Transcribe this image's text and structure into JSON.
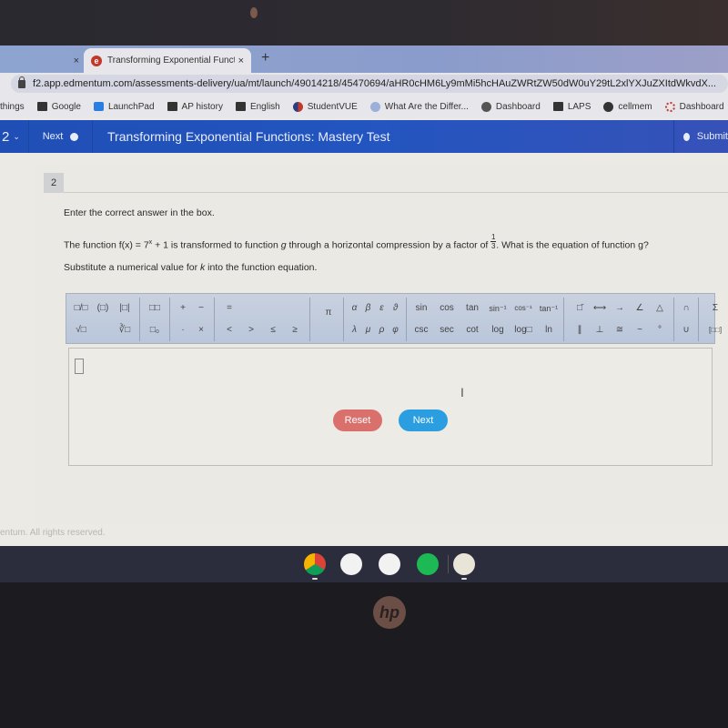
{
  "browser": {
    "prev_tab_close": "×",
    "active_tab": {
      "title": "Transforming Exponential Funct",
      "close": "×",
      "favicon": "e"
    },
    "new_tab": "+",
    "url": "f2.app.edmentum.com/assessments-delivery/ua/mt/launch/49014218/45470694/aHR0cHM6Ly9mMi5hcHAuZWRtZW50dW0uY29tL2xlYXJuZXItdWkvdX...",
    "bookmarks": [
      {
        "label": "things",
        "icon": "none"
      },
      {
        "label": "Google",
        "icon": "folder-icon"
      },
      {
        "label": "LaunchPad",
        "icon": "launchpad-icon"
      },
      {
        "label": "AP history",
        "icon": "folder-icon"
      },
      {
        "label": "English",
        "icon": "folder-icon"
      },
      {
        "label": "StudentVUE",
        "icon": "studentvue-icon"
      },
      {
        "label": "What Are the Differ...",
        "icon": "globe-icon"
      },
      {
        "label": "Dashboard",
        "icon": "dashboard-icon"
      },
      {
        "label": "LAPS",
        "icon": "folder-icon"
      },
      {
        "label": "cellmem",
        "icon": "globe-icon"
      },
      {
        "label": "Dashboard",
        "icon": "dashboard-ring-icon"
      }
    ]
  },
  "header": {
    "question_selector": "2",
    "next_label": "Next",
    "title": "Transforming Exponential Functions: Mastery Test",
    "submit_label": "Submit"
  },
  "question": {
    "number": "2",
    "instruction": "Enter the correct answer in the box.",
    "prompt_part1": "The function f(x) = 7",
    "prompt_exponent": "x",
    "prompt_part2": " + 1 is transformed to function ",
    "prompt_g": "g",
    "prompt_part3": " through a horizontal compression by a factor of ",
    "factor_numerator": "1",
    "factor_denominator": "3",
    "prompt_part4": ". What is the equation of function g?",
    "hint_part1": "Substitute a numerical value for ",
    "hint_k": "k",
    "hint_part2": " into the function equation."
  },
  "palette": {
    "groups": [
      {
        "name": "structures",
        "top": [
          "□/□",
          "(□)",
          "|□|"
        ],
        "bottom": [
          "√□",
          "",
          "∛□"
        ]
      },
      {
        "name": "scripts",
        "top": [
          "□□"
        ],
        "bottom": [
          "□₀"
        ]
      },
      {
        "name": "operators",
        "top": [
          "+",
          "−"
        ],
        "bottom": [
          "·",
          "×"
        ]
      },
      {
        "name": "relations",
        "top": [
          "=",
          "",
          "",
          ""
        ],
        "bottom": [
          "<",
          ">",
          "≤",
          "≥"
        ]
      },
      {
        "name": "constants",
        "top": [
          "π"
        ],
        "bottom": [
          ""
        ]
      },
      {
        "name": "greek",
        "top": [
          "α",
          "β",
          "ε",
          "ϑ"
        ],
        "bottom": [
          "λ",
          "μ",
          "ρ",
          "φ"
        ]
      },
      {
        "name": "trig",
        "top": [
          "sin",
          "cos",
          "tan",
          "sin⁻¹",
          "cos⁻¹",
          "tan⁻¹"
        ],
        "bottom": [
          "csc",
          "sec",
          "cot",
          "log",
          "log□",
          "ln"
        ]
      },
      {
        "name": "geometry",
        "top": [
          "□̄",
          "⟷",
          "→",
          "∠",
          "△"
        ],
        "bottom": [
          "∥",
          "⊥",
          "≅",
          "~",
          "°"
        ]
      },
      {
        "name": "sets",
        "top": [
          "∩"
        ],
        "bottom": [
          "∪"
        ]
      },
      {
        "name": "advanced",
        "top": [
          "Σ"
        ],
        "bottom": [
          "[□□]"
        ]
      }
    ]
  },
  "answer": {
    "value": ""
  },
  "buttons": {
    "reset": "Reset",
    "next": "Next"
  },
  "footer": {
    "copyright": "entum. All rights reserved."
  },
  "shelf": {
    "apps": [
      "chrome-icon",
      "gmail-icon",
      "docs-icon",
      "spotify-icon",
      "app-launcher-icon"
    ]
  },
  "colors": {
    "header_blue": "#2355c0",
    "reset_red": "#d9706c",
    "next_blue": "#2a9ee0"
  }
}
